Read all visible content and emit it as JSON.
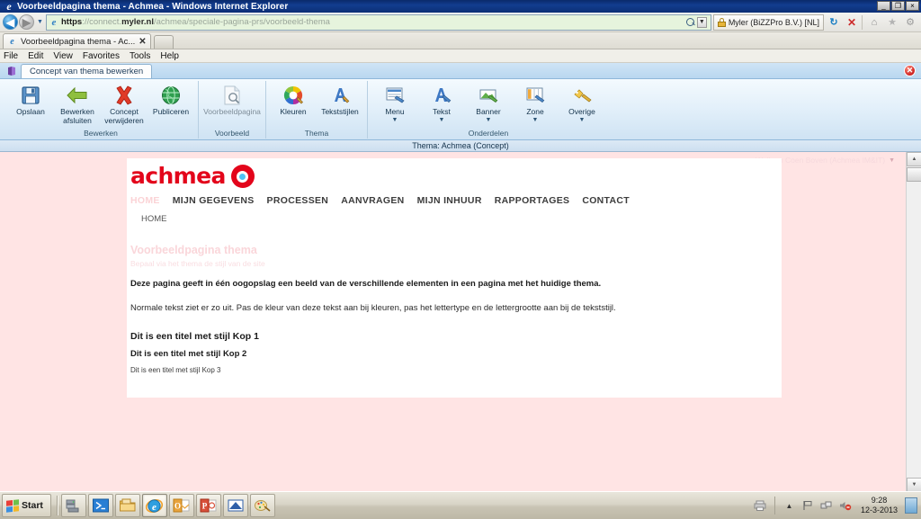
{
  "window": {
    "title": "Voorbeeldpagina thema - Achmea - Windows Internet Explorer",
    "minimize": "_",
    "maximize": "❐",
    "close": "×"
  },
  "browser": {
    "back_label": "◀",
    "forward_label": "▶",
    "history_caret": "▼",
    "url_scheme": "https",
    "url_sep": "://",
    "url_host_pre": "connect.",
    "url_host_strong": "myler.nl",
    "url_path": "/achmea/speciale-pagina-prs/voorbeeld-thema",
    "search_caret": "▼",
    "certificate": "Myler (BiZZPro B.V.) [NL]",
    "refresh_label": "↻",
    "stop_label": "✕",
    "home_label": "⌂",
    "favorites_label": "★",
    "tools_label": "⚙",
    "tabs": [
      {
        "title": "Voorbeeldpagina thema - Ac...",
        "close": "✕"
      }
    ],
    "new_tab_label": ""
  },
  "menubar": {
    "items": [
      "File",
      "Edit",
      "View",
      "Favorites",
      "Tools",
      "Help"
    ]
  },
  "ribbon": {
    "tab_label": "Concept van thema bewerken",
    "close_label": "✕",
    "groups": [
      {
        "label": "Bewerken",
        "buttons": [
          {
            "label": "Opslaan",
            "icon": "save-icon",
            "caret": false
          },
          {
            "label": "Bewerken afsluiten",
            "icon": "back-arrow-icon",
            "caret": false
          },
          {
            "label": "Concept verwijderen",
            "icon": "delete-cross-icon",
            "caret": false
          },
          {
            "label": "Publiceren",
            "icon": "globe-icon",
            "caret": false
          }
        ]
      },
      {
        "label": "Voorbeeld",
        "buttons": [
          {
            "label": "Voorbeeldpagina",
            "icon": "page-preview-icon",
            "caret": false,
            "dim": true
          }
        ]
      },
      {
        "label": "Thema",
        "buttons": [
          {
            "label": "Kleuren",
            "icon": "color-wheel-icon",
            "caret": false
          },
          {
            "label": "Tekststijlen",
            "icon": "text-styles-icon",
            "caret": false
          }
        ]
      },
      {
        "label": "Onderdelen",
        "buttons": [
          {
            "label": "Menu",
            "icon": "menu-component-icon",
            "caret": true
          },
          {
            "label": "Tekst",
            "icon": "text-component-icon",
            "caret": true
          },
          {
            "label": "Banner",
            "icon": "banner-component-icon",
            "caret": true
          },
          {
            "label": "Zone",
            "icon": "zone-component-icon",
            "caret": true
          },
          {
            "label": "Overige",
            "icon": "other-component-icon",
            "caret": true
          }
        ]
      }
    ]
  },
  "theme_bar": {
    "text": "Thema: Achmea (Concept)"
  },
  "page": {
    "welcome": "Welkom Coen Boven (Achmea IM&IT)",
    "welcome_caret": "▼",
    "logo_word": "achmea",
    "nav": [
      {
        "label": "HOME",
        "active": true
      },
      {
        "label": "MIJN GEGEVENS",
        "active": false
      },
      {
        "label": "PROCESSEN",
        "active": false
      },
      {
        "label": "AANVRAGEN",
        "active": false
      },
      {
        "label": "MIJN INHUUR",
        "active": false
      },
      {
        "label": "RAPPORTAGES",
        "active": false
      },
      {
        "label": "CONTACT",
        "active": false
      }
    ],
    "breadcrumb": "HOME",
    "title": "Voorbeeldpagina thema",
    "subtitle": "Bepaal via het thema de stijl van de site",
    "lead": "Deze pagina geeft in één oogopslag een beeld van de verschillende elementen in een pagina met het huidige thema.",
    "paragraph": "Normale tekst ziet er zo uit. Pas de kleur van deze tekst aan bij kleuren, pas het lettertype en de lettergrootte aan bij de tekststijl.",
    "kop1": "Dit is een titel met stijl Kop 1",
    "kop2": "Dit is een titel met stijl Kop 2",
    "kop3": "Dit is een titel met stijl Kop 3"
  },
  "scrollbar": {
    "up": "▲",
    "down": "▼"
  },
  "taskbar": {
    "start_label": "Start",
    "items": [
      {
        "name": "server-manager-icon",
        "active": false
      },
      {
        "name": "powershell-icon",
        "active": false
      },
      {
        "name": "explorer-folder-icon",
        "active": false
      },
      {
        "name": "internet-explorer-icon",
        "active": true
      },
      {
        "name": "outlook-icon",
        "active": false
      },
      {
        "name": "powerpoint-icon",
        "active": false
      },
      {
        "name": "visio-icon",
        "active": false
      },
      {
        "name": "paint-icon",
        "active": false
      }
    ],
    "tray_expand": "▲",
    "clock_time": "9:28",
    "clock_date": "12-3-2013"
  },
  "colors": {
    "accent_red": "#e3051b",
    "page_bg": "#ffe4e4",
    "title_bar": "#123d8f",
    "ribbon_blue": "#cfe3f3"
  }
}
